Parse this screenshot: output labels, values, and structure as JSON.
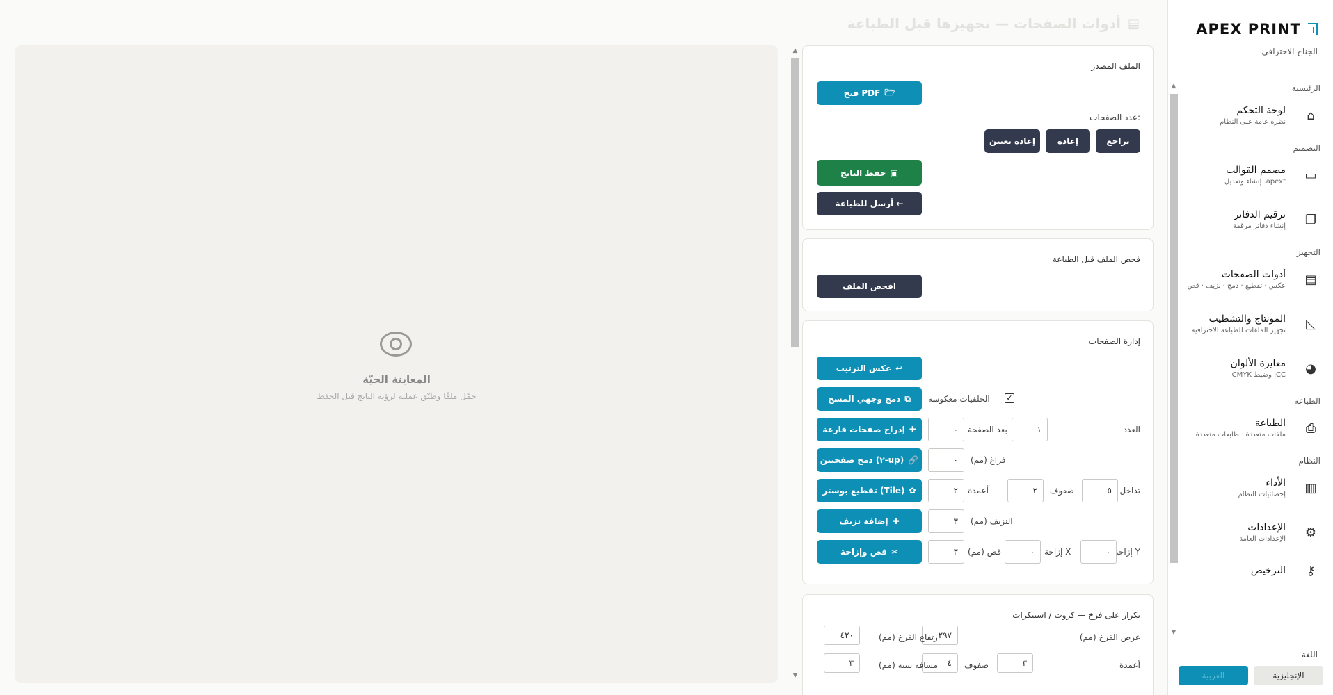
{
  "sidebar": {
    "brand": "APEX PRINT",
    "subtitle": "الجناح الاحترافي",
    "sections": {
      "home": "الرئيسية",
      "design": "التصميم",
      "prep": "التجهيز",
      "print": "الطباعة",
      "system": "النظام"
    },
    "items": [
      {
        "title": "لوحة التحكم",
        "desc": "نظرة عامة على النظام",
        "icon": "home-icon"
      },
      {
        "title": "مصمم القوالب",
        "desc": "إنشاء وتعديل .apext",
        "icon": "document-icon"
      },
      {
        "title": "ترقيم الدفاتر",
        "desc": "إنشاء دفاتر مرقمة",
        "icon": "copy-icon"
      },
      {
        "title": "أدوات الصفحات",
        "desc": "عكس · تقطيع · دمج · نزيف · قص",
        "icon": "toolbox-icon"
      },
      {
        "title": "المونتاج والتشطيب",
        "desc": "تجهيز الملفات للطباعة الاحترافية",
        "icon": "ruler-icon"
      },
      {
        "title": "معايرة الألوان",
        "desc": "CMYK وضبط ICC",
        "icon": "palette-icon"
      },
      {
        "title": "الطباعة",
        "desc": "ملفات متعددة · طابعات متعددة",
        "icon": "printer-icon"
      },
      {
        "title": "الأداء",
        "desc": "إحصائيات النظام",
        "icon": "chart-icon"
      },
      {
        "title": "الإعدادات",
        "desc": "الإعدادات العامة",
        "icon": "gear-icon"
      },
      {
        "title": "الترخيص",
        "desc": "",
        "icon": "key-icon"
      }
    ],
    "language_label": "اللغة",
    "lang_en": "الإنجليزية",
    "lang_ar": "العربية"
  },
  "header": {
    "title": "أدوات الصفحات — تجهيزها قبل الطباعة"
  },
  "preview": {
    "title": "المعاينة الحيّة",
    "subtitle": "حمّل ملفًا وطبّق عملية لرؤية الناتج قبل الحفظ"
  },
  "source": {
    "title": "الملف المصدر",
    "open_pdf": "فتح PDF",
    "page_count_label": "عدد الصفحات:",
    "undo": "تراجع",
    "redo": "إعادة",
    "reset": "إعادة تعيين",
    "save": "حفظ الناتج",
    "send_print": "أرسل للطباعة ←"
  },
  "preflight": {
    "title": "فحص الملف قبل الطباعة",
    "check": "افحص الملف"
  },
  "pages": {
    "title": "إدارة الصفحات",
    "reverse": "عكس الترتيب",
    "merge_scan": "دمج وجهي المسح",
    "backs_reversed": "الخلفيات معكوسة",
    "insert_blank": "إدراج صفحات فارغة",
    "count_label": "العدد",
    "count_value": "١",
    "after_label": "بعد الصفحة",
    "after_value": "٠",
    "two_up": "دمج صفحتين (٢-up)",
    "gap_label": "فراغ (مم)",
    "gap_value": "٠",
    "tile": "تقطيع بوستر (Tile)",
    "overlap_label": "تداخل",
    "overlap_value": "٥",
    "rows_label": "صفوف",
    "rows_value": "٢",
    "cols_label": "أعمدة",
    "cols_value": "٢",
    "bleed": "إضافة نزيف",
    "bleed_label": "النزيف (مم)",
    "bleed_value": "٣",
    "crop": "قص وإزاحة",
    "shift_y_label": "إزاحة Y",
    "shift_y_value": "٠",
    "shift_x_label": "إزاحة X",
    "shift_x_value": "٠",
    "crop_label": "قص (مم)",
    "crop_value": "٣"
  },
  "repeat": {
    "title": "تكرار على فرخ — كروت / استيكرات",
    "sheet_w_label": "عرض الفرخ (مم)",
    "sheet_w_value": "٢٩٧",
    "sheet_h_label": "ارتفاع الفرخ (مم)",
    "sheet_h_value": "٤٢٠",
    "cols_label": "أعمدة",
    "cols_value": "٣",
    "rows_label": "صفوف",
    "rows_value": "٤",
    "spacing_label": "مسافة بينية (مم)",
    "spacing_value": "٣"
  }
}
